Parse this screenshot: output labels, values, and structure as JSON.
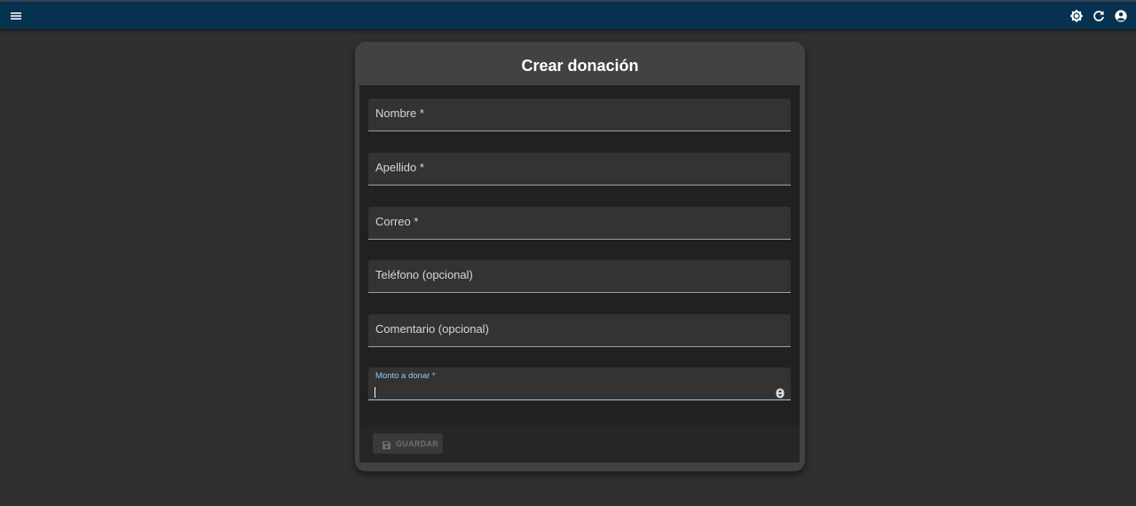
{
  "app_bar": {
    "background": "#06324f",
    "icons": [
      "menu-icon",
      "brightness-icon",
      "refresh-icon",
      "account-circle-icon"
    ]
  },
  "dialog": {
    "title": "Crear donación",
    "fields": [
      {
        "label": "Nombre *",
        "value": ""
      },
      {
        "label": "Apellido *",
        "value": ""
      },
      {
        "label": "Correo *",
        "value": ""
      },
      {
        "label": "Teléfono (opcional)",
        "value": ""
      },
      {
        "label": "Comentario (opcional)",
        "value": ""
      },
      {
        "label": "Monto a donar *",
        "value": "",
        "focused": true,
        "type": "number"
      }
    ],
    "save_button": {
      "label": "GUARDAR",
      "disabled": true,
      "icon": "save-icon"
    }
  },
  "colors": {
    "accent": "#90caf9",
    "background": "#303030",
    "card": "#424242"
  }
}
